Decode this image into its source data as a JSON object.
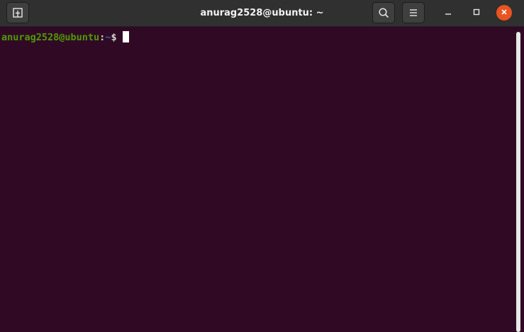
{
  "window": {
    "title": "anurag2528@ubuntu: ~"
  },
  "titlebar": {
    "buttons": {
      "new_tab_icon": "new-tab-icon",
      "search_icon": "search-icon",
      "menu_icon": "hamburger-menu-icon",
      "minimize_icon": "minimize-icon",
      "maximize_icon": "maximize-icon",
      "close_icon": "close-icon"
    }
  },
  "terminal": {
    "prompt": {
      "user_host": "anurag2528@ubuntu",
      "separator": ":",
      "path": "~",
      "symbol": "$"
    }
  },
  "colors": {
    "background": "#300a24",
    "titlebar": "#303030",
    "prompt_user": "#4e9a06",
    "prompt_path": "#3465a4",
    "close_button": "#e95420"
  }
}
